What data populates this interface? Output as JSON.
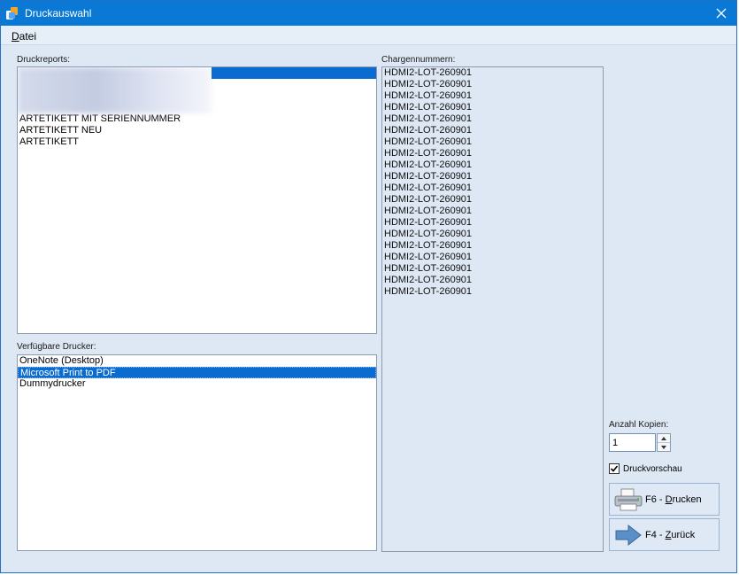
{
  "window": {
    "title": "Druckauswahl"
  },
  "menu": {
    "datei": "Datei"
  },
  "reports": {
    "label": "Druckreports:",
    "items": [
      "ARTETIKETT MIT SERIENNUMMER",
      "ARTETIKETT NEU",
      "ARTETIKETT"
    ]
  },
  "printers": {
    "label": "Verfügbare Drucker:",
    "items": [
      "OneNote (Desktop)",
      "Microsoft Print to PDF",
      "Dummydrucker"
    ],
    "selected_index": 1
  },
  "charges": {
    "label": "Chargennummern:",
    "items": [
      "HDMI2-LOT-260901",
      "HDMI2-LOT-260901",
      "HDMI2-LOT-260901",
      "HDMI2-LOT-260901",
      "HDMI2-LOT-260901",
      "HDMI2-LOT-260901",
      "HDMI2-LOT-260901",
      "HDMI2-LOT-260901",
      "HDMI2-LOT-260901",
      "HDMI2-LOT-260901",
      "HDMI2-LOT-260901",
      "HDMI2-LOT-260901",
      "HDMI2-LOT-260901",
      "HDMI2-LOT-260901",
      "HDMI2-LOT-260901",
      "HDMI2-LOT-260901",
      "HDMI2-LOT-260901",
      "HDMI2-LOT-260901",
      "HDMI2-LOT-260901",
      "HDMI2-LOT-260901"
    ]
  },
  "copies": {
    "label": "Anzahl Kopien:",
    "value": "1"
  },
  "preview": {
    "label": "Druckvorschau",
    "checked": true
  },
  "buttons": {
    "print_prefix": "F6 - ",
    "print_accel": "D",
    "print_rest": "rucken",
    "back_prefix": "F4 - ",
    "back_accel": "Z",
    "back_rest": "urück"
  },
  "colors": {
    "titlebar": "#0a79d6",
    "selection": "#0a6cd0",
    "background": "#dde8f4"
  }
}
